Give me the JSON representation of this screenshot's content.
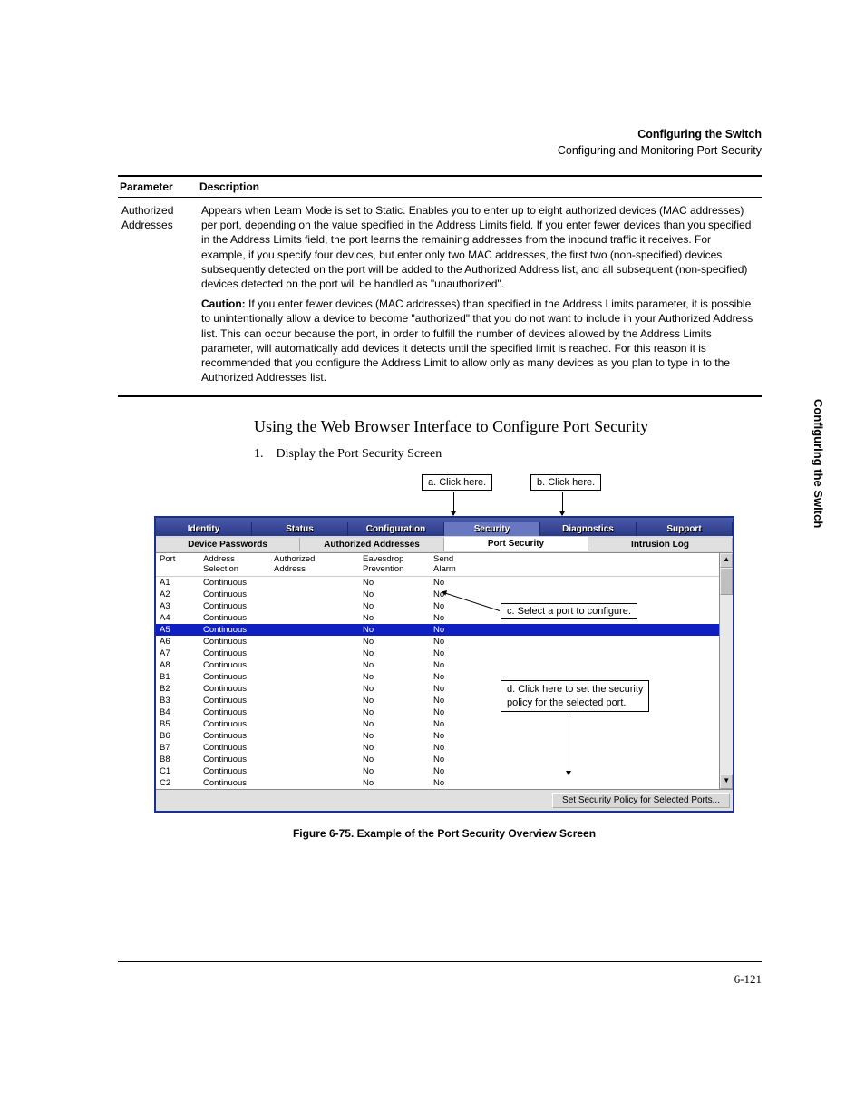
{
  "header": {
    "title_bold": "Configuring the Switch",
    "subtitle": "Configuring and Monitoring Port Security"
  },
  "param_table": {
    "head_param": "Parameter",
    "head_desc": "Description",
    "param_name": "Authorized Addresses",
    "desc_p1": "Appears when Learn Mode is set to Static. Enables you to enter up to eight authorized devices (MAC addresses) per port, depending on the value specified in the Address Limits field. If you enter fewer devices than you specified in the Address Limits field, the port learns the remaining addresses from the inbound traffic it receives. For example, if you specify four devices, but enter only two MAC addresses, the first two (non-specified) devices subsequently detected on the port will be added to the Authorized Address list, and all subsequent (non-specified) devices detected on the port will be handled as \"unauthorized\".",
    "caution_label": "Caution:",
    "desc_p2": " If you enter fewer devices (MAC addresses) than specified in the Address Limits parameter, it is possible to unintentionally allow a device to become \"authorized\" that you do not want to include in your Authorized Address list. This can occur because the port, in order to fulfill the number of devices allowed by the Address Limits parameter, will automatically add devices it detects until the specified limit is reached. For this reason it is recommended that you configure the Address Limit to allow only as many devices as you plan to type in to the Authorized Addresses list."
  },
  "section_title": "Using the Web Browser Interface to Configure Port Security",
  "step1": "1. Display the Port Security Screen",
  "callouts": {
    "a": "a. Click here.",
    "b": "b. Click here.",
    "c": "c. Select a port to configure.",
    "d1": "d. Click here to set the security",
    "d2": "policy for the selected port."
  },
  "app": {
    "tabs": [
      "Identity",
      "Status",
      "Configuration",
      "Security",
      "Diagnostics",
      "Support"
    ],
    "active_tab": 3,
    "subtabs": [
      "Device Passwords",
      "Authorized Addresses",
      "Port Security",
      "Intrusion Log"
    ],
    "active_subtab": 2,
    "columns": {
      "port": "Port",
      "addr_sel_l1": "Address",
      "addr_sel_l2": "Selection",
      "auth_addr_l1": "Authorized",
      "auth_addr_l2": "Address",
      "eaves_l1": "Eavesdrop",
      "eaves_l2": "Prevention",
      "send_l1": "Send",
      "send_l2": "Alarm"
    },
    "rows": [
      {
        "port": "A1",
        "addr": "Continuous",
        "eaves": "No",
        "send": "No",
        "sel": false
      },
      {
        "port": "A2",
        "addr": "Continuous",
        "eaves": "No",
        "send": "No",
        "sel": false
      },
      {
        "port": "A3",
        "addr": "Continuous",
        "eaves": "No",
        "send": "No",
        "sel": false
      },
      {
        "port": "A4",
        "addr": "Continuous",
        "eaves": "No",
        "send": "No",
        "sel": false
      },
      {
        "port": "A5",
        "addr": "Continuous",
        "eaves": "No",
        "send": "No",
        "sel": true
      },
      {
        "port": "A6",
        "addr": "Continuous",
        "eaves": "No",
        "send": "No",
        "sel": false
      },
      {
        "port": "A7",
        "addr": "Continuous",
        "eaves": "No",
        "send": "No",
        "sel": false
      },
      {
        "port": "A8",
        "addr": "Continuous",
        "eaves": "No",
        "send": "No",
        "sel": false
      },
      {
        "port": "B1",
        "addr": "Continuous",
        "eaves": "No",
        "send": "No",
        "sel": false
      },
      {
        "port": "B2",
        "addr": "Continuous",
        "eaves": "No",
        "send": "No",
        "sel": false
      },
      {
        "port": "B3",
        "addr": "Continuous",
        "eaves": "No",
        "send": "No",
        "sel": false
      },
      {
        "port": "B4",
        "addr": "Continuous",
        "eaves": "No",
        "send": "No",
        "sel": false
      },
      {
        "port": "B5",
        "addr": "Continuous",
        "eaves": "No",
        "send": "No",
        "sel": false
      },
      {
        "port": "B6",
        "addr": "Continuous",
        "eaves": "No",
        "send": "No",
        "sel": false
      },
      {
        "port": "B7",
        "addr": "Continuous",
        "eaves": "No",
        "send": "No",
        "sel": false
      },
      {
        "port": "B8",
        "addr": "Continuous",
        "eaves": "No",
        "send": "No",
        "sel": false
      },
      {
        "port": "C1",
        "addr": "Continuous",
        "eaves": "No",
        "send": "No",
        "sel": false
      },
      {
        "port": "C2",
        "addr": "Continuous",
        "eaves": "No",
        "send": "No",
        "sel": false
      }
    ],
    "button": "Set Security Policy for Selected Ports..."
  },
  "figure_caption": "Figure 6-75.  Example of the Port Security Overview Screen",
  "side_label": "Configuring the Switch",
  "page_number": "6-121"
}
